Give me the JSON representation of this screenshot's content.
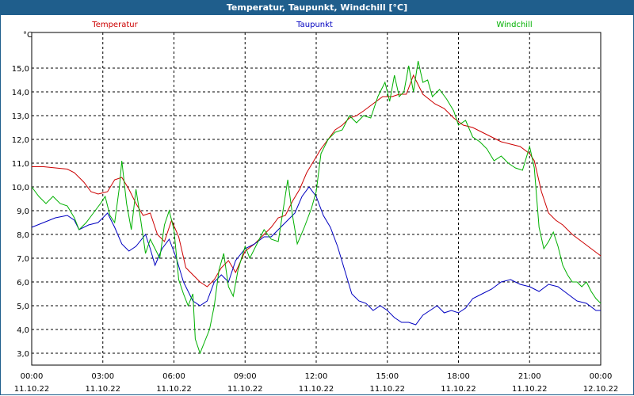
{
  "window": {
    "title": "Temperatur, Taupunkt, Windchill [°C]"
  },
  "chart_data": {
    "type": "line",
    "title": "Temperatur, Taupunkt, Windchill [°C]",
    "ylabel": "°C",
    "ylim": [
      2.5,
      16.5
    ],
    "yticks": [
      3.0,
      4.0,
      5.0,
      6.0,
      7.0,
      8.0,
      9.0,
      10.0,
      11.0,
      12.0,
      13.0,
      14.0,
      15.0
    ],
    "ytick_labels": [
      "3,0",
      "4,0",
      "5,0",
      "6,0",
      "7,0",
      "8,0",
      "9,0",
      "10,0",
      "11,0",
      "12,0",
      "13,0",
      "14,0",
      "15,0"
    ],
    "xlim": [
      0,
      24
    ],
    "xticks": [
      0,
      3,
      6,
      9,
      12,
      15,
      18,
      21,
      24
    ],
    "xtick_labels": [
      {
        "time": "00:00",
        "date": "11.10.22"
      },
      {
        "time": "03:00",
        "date": "11.10.22"
      },
      {
        "time": "06:00",
        "date": "11.10.22"
      },
      {
        "time": "09:00",
        "date": "11.10.22"
      },
      {
        "time": "12:00",
        "date": "11.10.22"
      },
      {
        "time": "15:00",
        "date": "11.10.22"
      },
      {
        "time": "18:00",
        "date": "11.10.22"
      },
      {
        "time": "21:00",
        "date": "11.10.22"
      },
      {
        "time": "00:00",
        "date": "12.10.22"
      }
    ],
    "grid": true,
    "legend": "top",
    "series": [
      {
        "name": "Temperatur",
        "color": "#cc0000",
        "points": [
          [
            0,
            10.85
          ],
          [
            0.5,
            10.85
          ],
          [
            1,
            10.8
          ],
          [
            1.5,
            10.75
          ],
          [
            1.8,
            10.6
          ],
          [
            2.2,
            10.2
          ],
          [
            2.5,
            9.8
          ],
          [
            2.8,
            9.7
          ],
          [
            3.2,
            9.8
          ],
          [
            3.5,
            10.3
          ],
          [
            3.8,
            10.4
          ],
          [
            4.1,
            9.9
          ],
          [
            4.4,
            9.3
          ],
          [
            4.7,
            8.8
          ],
          [
            5,
            8.9
          ],
          [
            5.3,
            8.0
          ],
          [
            5.6,
            7.7
          ],
          [
            5.9,
            8.6
          ],
          [
            6.2,
            7.9
          ],
          [
            6.5,
            6.6
          ],
          [
            6.8,
            6.3
          ],
          [
            7.1,
            6.0
          ],
          [
            7.4,
            5.8
          ],
          [
            7.7,
            6.1
          ],
          [
            8.0,
            6.6
          ],
          [
            8.3,
            6.9
          ],
          [
            8.6,
            6.4
          ],
          [
            9.0,
            7.3
          ],
          [
            9.4,
            7.6
          ],
          [
            9.8,
            8.0
          ],
          [
            10.1,
            8.3
          ],
          [
            10.4,
            8.7
          ],
          [
            10.7,
            8.8
          ],
          [
            11.0,
            9.4
          ],
          [
            11.3,
            9.9
          ],
          [
            11.6,
            10.6
          ],
          [
            11.9,
            11.1
          ],
          [
            12.2,
            11.6
          ],
          [
            12.5,
            12.0
          ],
          [
            12.8,
            12.4
          ],
          [
            13.1,
            12.6
          ],
          [
            13.4,
            12.9
          ],
          [
            13.7,
            13.0
          ],
          [
            14.0,
            13.2
          ],
          [
            14.4,
            13.5
          ],
          [
            14.8,
            13.8
          ],
          [
            15.2,
            13.8
          ],
          [
            15.5,
            13.9
          ],
          [
            15.8,
            13.9
          ],
          [
            16.1,
            14.7
          ],
          [
            16.5,
            13.9
          ],
          [
            17.0,
            13.5
          ],
          [
            17.4,
            13.3
          ],
          [
            17.8,
            12.9
          ],
          [
            18.2,
            12.6
          ],
          [
            18.6,
            12.5
          ],
          [
            19.0,
            12.3
          ],
          [
            19.4,
            12.1
          ],
          [
            19.8,
            11.9
          ],
          [
            20.2,
            11.8
          ],
          [
            20.6,
            11.7
          ],
          [
            21.0,
            11.4
          ],
          [
            21.2,
            11.1
          ],
          [
            21.5,
            9.8
          ],
          [
            21.8,
            8.9
          ],
          [
            22.1,
            8.6
          ],
          [
            22.4,
            8.4
          ],
          [
            22.8,
            8.0
          ],
          [
            23.2,
            7.7
          ],
          [
            23.6,
            7.4
          ],
          [
            24.0,
            7.1
          ]
        ]
      },
      {
        "name": "Taupunkt",
        "color": "#0000c0",
        "points": [
          [
            0,
            8.3
          ],
          [
            0.5,
            8.5
          ],
          [
            1,
            8.7
          ],
          [
            1.5,
            8.8
          ],
          [
            1.8,
            8.6
          ],
          [
            2.0,
            8.2
          ],
          [
            2.4,
            8.4
          ],
          [
            2.8,
            8.5
          ],
          [
            3.2,
            8.9
          ],
          [
            3.5,
            8.3
          ],
          [
            3.8,
            7.6
          ],
          [
            4.1,
            7.3
          ],
          [
            4.4,
            7.5
          ],
          [
            4.8,
            8.0
          ],
          [
            5.0,
            7.4
          ],
          [
            5.2,
            6.7
          ],
          [
            5.5,
            7.4
          ],
          [
            5.8,
            7.8
          ],
          [
            6.1,
            7.0
          ],
          [
            6.4,
            6.0
          ],
          [
            6.8,
            5.2
          ],
          [
            7.1,
            5.0
          ],
          [
            7.4,
            5.2
          ],
          [
            7.7,
            6.0
          ],
          [
            8.0,
            6.3
          ],
          [
            8.3,
            6.0
          ],
          [
            8.6,
            6.9
          ],
          [
            9.0,
            7.4
          ],
          [
            9.4,
            7.6
          ],
          [
            9.8,
            7.9
          ],
          [
            10.1,
            7.9
          ],
          [
            10.5,
            8.3
          ],
          [
            10.8,
            8.6
          ],
          [
            11.1,
            8.9
          ],
          [
            11.4,
            9.6
          ],
          [
            11.7,
            10.0
          ],
          [
            12.0,
            9.6
          ],
          [
            12.3,
            8.8
          ],
          [
            12.6,
            8.3
          ],
          [
            12.9,
            7.5
          ],
          [
            13.2,
            6.5
          ],
          [
            13.5,
            5.5
          ],
          [
            13.8,
            5.2
          ],
          [
            14.1,
            5.1
          ],
          [
            14.4,
            4.8
          ],
          [
            14.7,
            5.0
          ],
          [
            15.0,
            4.8
          ],
          [
            15.3,
            4.5
          ],
          [
            15.6,
            4.3
          ],
          [
            15.9,
            4.3
          ],
          [
            16.2,
            4.2
          ],
          [
            16.5,
            4.6
          ],
          [
            16.8,
            4.8
          ],
          [
            17.1,
            5.0
          ],
          [
            17.4,
            4.7
          ],
          [
            17.7,
            4.8
          ],
          [
            18.0,
            4.7
          ],
          [
            18.3,
            4.9
          ],
          [
            18.6,
            5.3
          ],
          [
            19.0,
            5.5
          ],
          [
            19.4,
            5.7
          ],
          [
            19.8,
            6.0
          ],
          [
            20.2,
            6.1
          ],
          [
            20.6,
            5.9
          ],
          [
            21.0,
            5.8
          ],
          [
            21.4,
            5.6
          ],
          [
            21.8,
            5.9
          ],
          [
            22.2,
            5.8
          ],
          [
            22.6,
            5.5
          ],
          [
            23.0,
            5.2
          ],
          [
            23.4,
            5.1
          ],
          [
            23.8,
            4.8
          ],
          [
            24.0,
            4.8
          ]
        ]
      },
      {
        "name": "Windchill",
        "color": "#00b000",
        "points": [
          [
            0,
            10.0
          ],
          [
            0.3,
            9.6
          ],
          [
            0.6,
            9.3
          ],
          [
            0.9,
            9.6
          ],
          [
            1.2,
            9.3
          ],
          [
            1.5,
            9.2
          ],
          [
            1.8,
            8.7
          ],
          [
            2.0,
            8.2
          ],
          [
            2.3,
            8.5
          ],
          [
            2.6,
            8.9
          ],
          [
            2.9,
            9.3
          ],
          [
            3.1,
            9.6
          ],
          [
            3.3,
            8.8
          ],
          [
            3.5,
            8.5
          ],
          [
            3.7,
            10.0
          ],
          [
            3.8,
            11.1
          ],
          [
            4.0,
            9.3
          ],
          [
            4.2,
            8.2
          ],
          [
            4.4,
            9.9
          ],
          [
            4.6,
            8.6
          ],
          [
            4.8,
            7.2
          ],
          [
            5.0,
            7.8
          ],
          [
            5.2,
            7.4
          ],
          [
            5.4,
            7.0
          ],
          [
            5.6,
            8.4
          ],
          [
            5.8,
            9.0
          ],
          [
            6.0,
            8.2
          ],
          [
            6.2,
            6.1
          ],
          [
            6.4,
            5.5
          ],
          [
            6.6,
            5.0
          ],
          [
            6.8,
            5.5
          ],
          [
            6.9,
            3.6
          ],
          [
            7.1,
            3.0
          ],
          [
            7.3,
            3.5
          ],
          [
            7.5,
            4.0
          ],
          [
            7.7,
            5.0
          ],
          [
            7.9,
            6.5
          ],
          [
            8.1,
            7.2
          ],
          [
            8.3,
            5.8
          ],
          [
            8.5,
            5.4
          ],
          [
            8.7,
            6.5
          ],
          [
            9.0,
            7.5
          ],
          [
            9.2,
            7.0
          ],
          [
            9.5,
            7.6
          ],
          [
            9.8,
            8.2
          ],
          [
            10.1,
            7.8
          ],
          [
            10.4,
            7.7
          ],
          [
            10.8,
            10.3
          ],
          [
            11.0,
            8.8
          ],
          [
            11.2,
            7.6
          ],
          [
            11.5,
            8.3
          ],
          [
            11.8,
            9.1
          ],
          [
            12.0,
            9.8
          ],
          [
            12.2,
            11.4
          ],
          [
            12.5,
            12.0
          ],
          [
            12.8,
            12.3
          ],
          [
            13.1,
            12.4
          ],
          [
            13.4,
            13.0
          ],
          [
            13.7,
            12.7
          ],
          [
            14.0,
            13.0
          ],
          [
            14.3,
            12.9
          ],
          [
            14.6,
            13.8
          ],
          [
            14.9,
            14.4
          ],
          [
            15.1,
            13.6
          ],
          [
            15.3,
            14.7
          ],
          [
            15.5,
            13.8
          ],
          [
            15.7,
            14.0
          ],
          [
            15.9,
            15.1
          ],
          [
            16.1,
            14.0
          ],
          [
            16.3,
            15.3
          ],
          [
            16.5,
            14.4
          ],
          [
            16.7,
            14.5
          ],
          [
            16.9,
            13.8
          ],
          [
            17.2,
            14.1
          ],
          [
            17.5,
            13.7
          ],
          [
            17.8,
            13.2
          ],
          [
            18.0,
            12.6
          ],
          [
            18.3,
            12.8
          ],
          [
            18.6,
            12.1
          ],
          [
            18.9,
            11.9
          ],
          [
            19.2,
            11.6
          ],
          [
            19.5,
            11.1
          ],
          [
            19.8,
            11.3
          ],
          [
            20.1,
            11.0
          ],
          [
            20.4,
            10.8
          ],
          [
            20.7,
            10.7
          ],
          [
            21.0,
            11.7
          ],
          [
            21.2,
            10.8
          ],
          [
            21.4,
            8.3
          ],
          [
            21.6,
            7.4
          ],
          [
            21.8,
            7.7
          ],
          [
            22.0,
            8.1
          ],
          [
            22.2,
            7.5
          ],
          [
            22.4,
            6.7
          ],
          [
            22.6,
            6.3
          ],
          [
            22.8,
            6.0
          ],
          [
            23.0,
            6.0
          ],
          [
            23.2,
            5.8
          ],
          [
            23.4,
            6.0
          ],
          [
            23.6,
            5.6
          ],
          [
            23.8,
            5.3
          ],
          [
            24.0,
            5.1
          ]
        ]
      }
    ]
  }
}
